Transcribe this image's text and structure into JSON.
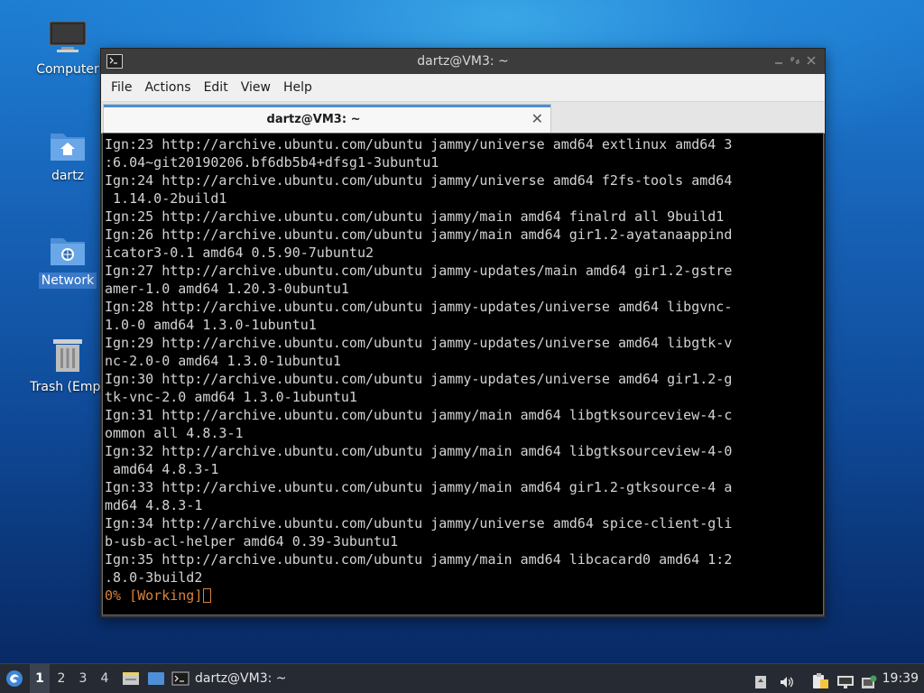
{
  "desktop": {
    "icons": [
      {
        "label": "Computer"
      },
      {
        "label": "dartz"
      },
      {
        "label": "Network"
      },
      {
        "label": "Trash (Empt"
      }
    ]
  },
  "window": {
    "title": "dartz@VM3: ~",
    "menu": [
      "File",
      "Actions",
      "Edit",
      "View",
      "Help"
    ],
    "tab": {
      "label": "dartz@VM3: ~"
    }
  },
  "terminal": {
    "lines": [
      "Ign:23 http://archive.ubuntu.com/ubuntu jammy/universe amd64 extlinux amd64 3",
      ":6.04~git20190206.bf6db5b4+dfsg1-3ubuntu1",
      "Ign:24 http://archive.ubuntu.com/ubuntu jammy/universe amd64 f2fs-tools amd64",
      " 1.14.0-2build1",
      "Ign:25 http://archive.ubuntu.com/ubuntu jammy/main amd64 finalrd all 9build1",
      "Ign:26 http://archive.ubuntu.com/ubuntu jammy/main amd64 gir1.2-ayatanaappind",
      "icator3-0.1 amd64 0.5.90-7ubuntu2",
      "Ign:27 http://archive.ubuntu.com/ubuntu jammy-updates/main amd64 gir1.2-gstre",
      "amer-1.0 amd64 1.20.3-0ubuntu1",
      "Ign:28 http://archive.ubuntu.com/ubuntu jammy-updates/universe amd64 libgvnc-",
      "1.0-0 amd64 1.3.0-1ubuntu1",
      "Ign:29 http://archive.ubuntu.com/ubuntu jammy-updates/universe amd64 libgtk-v",
      "nc-2.0-0 amd64 1.3.0-1ubuntu1",
      "Ign:30 http://archive.ubuntu.com/ubuntu jammy-updates/universe amd64 gir1.2-g",
      "tk-vnc-2.0 amd64 1.3.0-1ubuntu1",
      "Ign:31 http://archive.ubuntu.com/ubuntu jammy/main amd64 libgtksourceview-4-c",
      "ommon all 4.8.3-1",
      "Ign:32 http://archive.ubuntu.com/ubuntu jammy/main amd64 libgtksourceview-4-0",
      " amd64 4.8.3-1",
      "Ign:33 http://archive.ubuntu.com/ubuntu jammy/main amd64 gir1.2-gtksource-4 a",
      "md64 4.8.3-1",
      "Ign:34 http://archive.ubuntu.com/ubuntu jammy/universe amd64 spice-client-gli",
      "b-usb-acl-helper amd64 0.39-3ubuntu1",
      "Ign:35 http://archive.ubuntu.com/ubuntu jammy/main amd64 libcacard0 amd64 1:2",
      ".8.0-3build2"
    ],
    "status": "0% [Working]",
    "status_color": "#d9823b"
  },
  "taskbar": {
    "workspaces": [
      "1",
      "2",
      "3",
      "4"
    ],
    "active_workspace": "1",
    "task_label": "dartz@VM3: ~",
    "clock": "19:39",
    "icons": [
      "start-menu-icon",
      "file-manager-icon",
      "desktop-icon",
      "terminal-icon",
      "volume-icon",
      "clipboard-icon",
      "network-icon",
      "notification-icon"
    ]
  },
  "colors": {
    "tab_accent": "#4a8fd7",
    "selection": "#3b79c9"
  }
}
